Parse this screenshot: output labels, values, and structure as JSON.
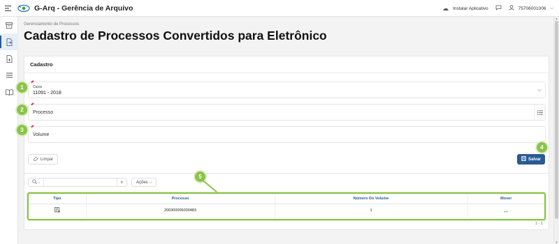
{
  "app": {
    "title": "G-Arq - Gerência de Arquivo",
    "install_label": "Instalar Aplicativo",
    "user_id": "75706001006"
  },
  "breadcrumb": "Gerenciamento de Processos",
  "page_title": "Cadastro de Processos Convertidos para Eletrônico",
  "form": {
    "section_title": "Cadastro",
    "caixa": {
      "label": "Caixa",
      "value": "11091 - 2018"
    },
    "processo": {
      "placeholder": "Processo"
    },
    "volume": {
      "placeholder": "Volume"
    },
    "limpar_label": "Limpar",
    "salvar_label": "Salvar"
  },
  "badges": [
    "1",
    "2",
    "3",
    "4",
    "5"
  ],
  "table": {
    "ir_label": "Ir",
    "acoes_label": "Ações",
    "columns": [
      "Tipo",
      "Processo",
      "Número Do Volume",
      "Mover"
    ],
    "rows": [
      {
        "tipo_icon": "document-list-icon",
        "processo": "200300006030483",
        "numero_volume": "1",
        "mover_icon": "swap-arrows-icon"
      }
    ],
    "pagination": "1 - 1"
  },
  "colors": {
    "primary": "#2a5a94",
    "highlight": "#8bc34a",
    "required": "#dd3333"
  }
}
